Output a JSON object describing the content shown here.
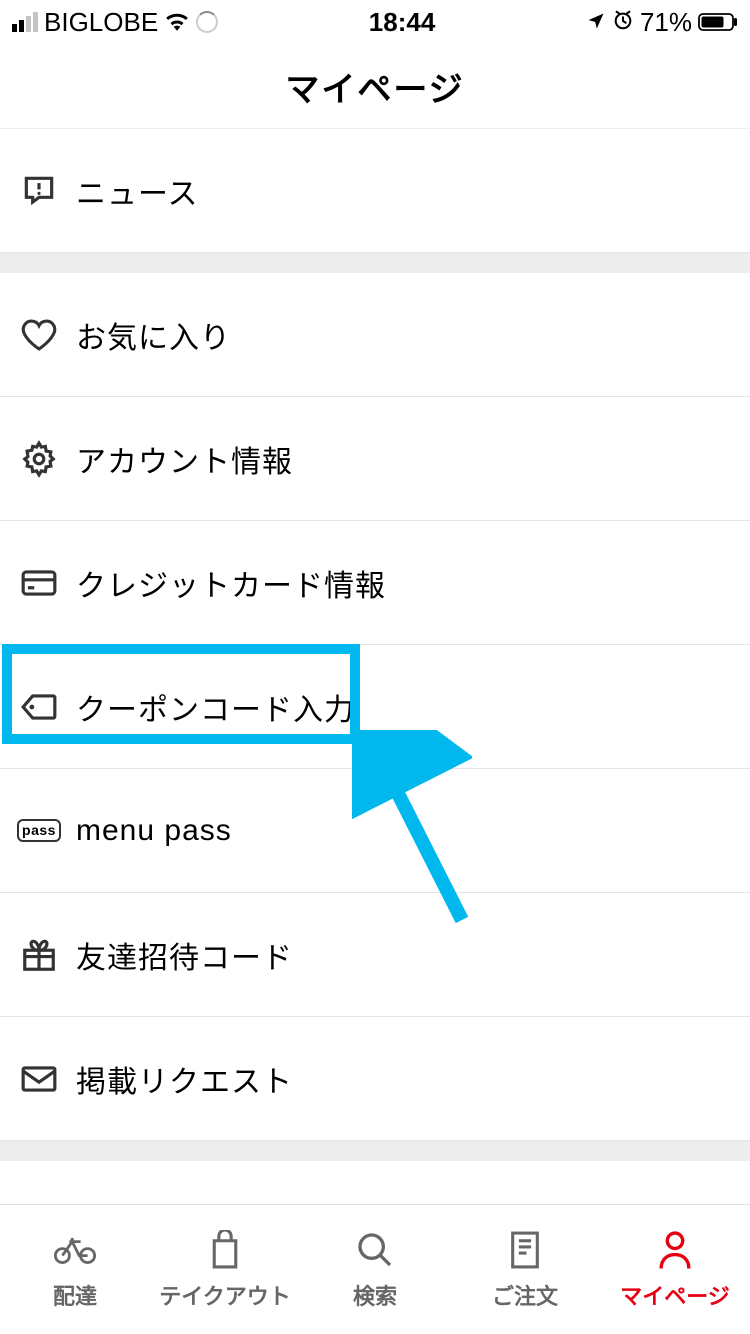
{
  "status": {
    "carrier": "BIGLOBE",
    "time": "18:44",
    "battery": "71%"
  },
  "header": {
    "title": "マイページ"
  },
  "sections": [
    {
      "items": [
        {
          "key": "news",
          "label": "ニュース"
        }
      ]
    },
    {
      "items": [
        {
          "key": "favorites",
          "label": "お気に入り"
        },
        {
          "key": "account",
          "label": "アカウント情報"
        },
        {
          "key": "credit",
          "label": "クレジットカード情報"
        },
        {
          "key": "coupon",
          "label": "クーポンコード入力"
        },
        {
          "key": "menupass",
          "label": "menu pass"
        },
        {
          "key": "invite",
          "label": "友達招待コード"
        },
        {
          "key": "request",
          "label": "掲載リクエスト"
        }
      ]
    }
  ],
  "tabs": [
    {
      "key": "delivery",
      "label": "配達"
    },
    {
      "key": "takeout",
      "label": "テイクアウト"
    },
    {
      "key": "search",
      "label": "検索"
    },
    {
      "key": "order",
      "label": "ご注文"
    },
    {
      "key": "mypage",
      "label": "マイページ",
      "active": true
    }
  ],
  "annotation": {
    "highlight_color": "#00b8ee"
  }
}
